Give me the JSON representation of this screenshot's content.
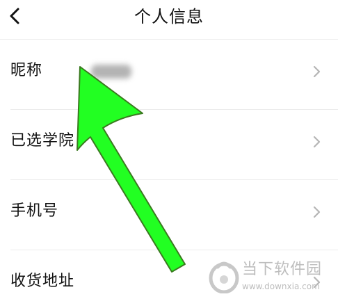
{
  "header": {
    "back_icon": "chevron-left-icon",
    "title": "个人信息"
  },
  "rows": [
    {
      "label": "昵称",
      "value_blurred": true,
      "chevron_icon": "chevron-right-icon"
    },
    {
      "label": "已选学院",
      "chevron_icon": "chevron-right-icon"
    },
    {
      "label": "手机号",
      "chevron_icon": "chevron-right-icon"
    },
    {
      "label": "收货地址",
      "chevron_icon": "chevron-right-icon"
    }
  ],
  "annotation": {
    "type": "arrow",
    "color": "#22ff22",
    "outline_color": "#3a7a1f",
    "points_to": "昵称"
  },
  "watermark": {
    "name": "当下软件园",
    "url": "www.downxia.com",
    "color": "#bdbdbd"
  }
}
